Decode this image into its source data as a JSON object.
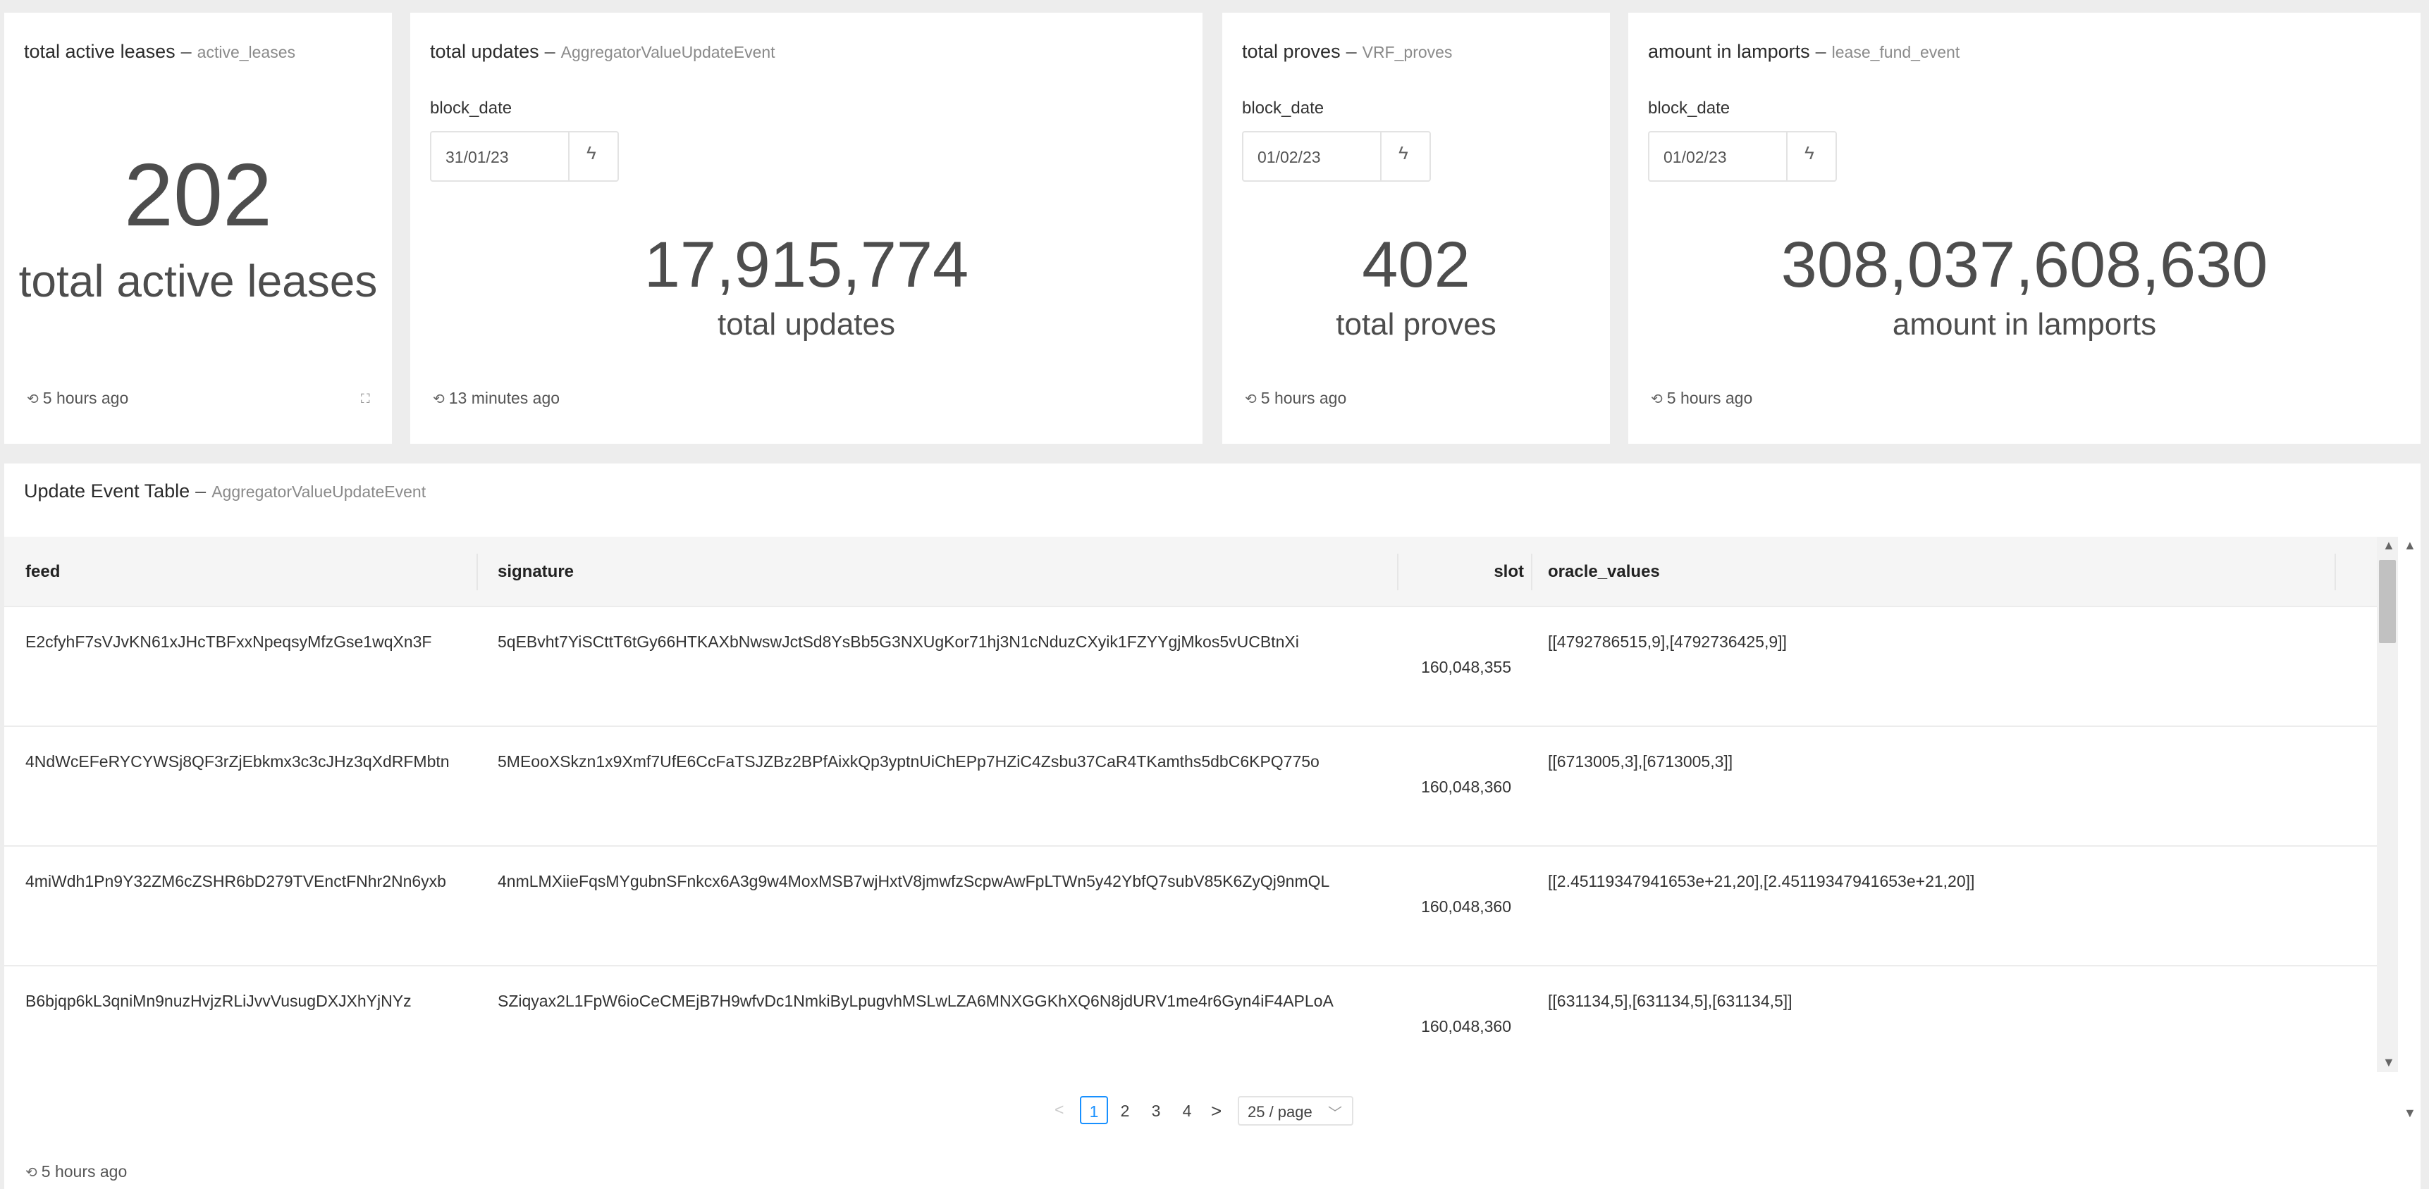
{
  "cards": [
    {
      "title": "total active leases",
      "source": "active_leases",
      "value": "202",
      "label": "total active leases",
      "footer": "5 hours ago"
    },
    {
      "title": "total updates",
      "source": "AggregatorValueUpdateEvent",
      "filter_label": "block_date",
      "filter_value": "31/01/23",
      "value": "17,915,774",
      "label": "total updates",
      "footer": "13 minutes ago"
    },
    {
      "title": "total proves",
      "source": "VRF_proves",
      "filter_label": "block_date",
      "filter_value": "01/02/23",
      "value": "402",
      "label": "total proves",
      "footer": "5 hours ago"
    },
    {
      "title": "amount in lamports",
      "source": "lease_fund_event",
      "filter_label": "block_date",
      "filter_value": "01/02/23",
      "value": "308,037,608,630",
      "label": "amount in lamports",
      "footer": "5 hours ago"
    }
  ],
  "table_card": {
    "title": "Update Event Table",
    "source": "AggregatorValueUpdateEvent",
    "footer": "5 hours ago",
    "columns": [
      "feed",
      "signature",
      "slot",
      "oracle_values"
    ],
    "rows": [
      {
        "feed": "E2cfyhF7sVJvKN61xJHcTBFxxNpeqsyMfzGse1wqXn3F",
        "signature": "5qEBvht7YiSCttT6tGy66HTKAXbNwswJctSd8YsBb5G3NXUgKor71hj3N1cNduzCXyik1FZYYgjMkos5vUCBtnXi",
        "slot": "160,048,355",
        "oracle_values": "[[4792786515,9],[4792736425,9]]"
      },
      {
        "feed": "4NdWcEFeRYCYWSj8QF3rZjEbkmx3c3cJHz3qXdRFMbtn",
        "signature": "5MEooXSkzn1x9Xmf7UfE6CcFaTSJZBz2BPfAixkQp3yptnUiChEPp7HZiC4Zsbu37CaR4TKamths5dbC6KPQ775o",
        "slot": "160,048,360",
        "oracle_values": "[[6713005,3],[6713005,3]]"
      },
      {
        "feed": "4miWdh1Pn9Y32ZM6cZSHR6bD279TVEnctFNhr2Nn6yxb",
        "signature": "4nmLMXiieFqsMYgubnSFnkcx6A3g9w4MoxMSB7wjHxtV8jmwfzScpwAwFpLTWn5y42YbfQ7subV85K6ZyQj9nmQL",
        "slot": "160,048,360",
        "oracle_values": "[[2.45119347941653e+21,20],[2.45119347941653e+21,20]]"
      },
      {
        "feed": "B6bjqp6kL3qniMn9nuzHvjzRLiJvvVusugDXJXhYjNYz",
        "signature": "SZiqyax2L1FpW6ioCeCMEjB7H9wfvDc1NmkiByLpugvhMSLwLZA6MNXGGKhXQ6N8jdURV1me4r6Gyn4iF4APLoA",
        "slot": "160,048,360",
        "oracle_values": "[[631134,5],[631134,5],[631134,5]]"
      }
    ]
  },
  "pagination": {
    "prev": "<",
    "pages": [
      "1",
      "2",
      "3",
      "4"
    ],
    "current": "1",
    "next": ">",
    "page_size": "25 / page"
  },
  "icons": {
    "clock": "clock-icon",
    "bolt": "bolt-icon",
    "expand": "expand-icon"
  },
  "colors": {
    "accent": "#1890ff",
    "background": "#ededed",
    "card": "#ffffff"
  }
}
